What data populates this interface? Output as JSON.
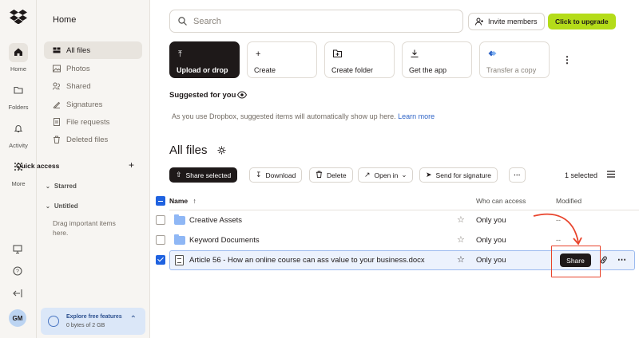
{
  "rail": {
    "items": [
      {
        "label": "Home",
        "icon": "home-icon"
      },
      {
        "label": "Folders",
        "icon": "folder-icon"
      },
      {
        "label": "Activity",
        "icon": "bell-icon"
      },
      {
        "label": "More",
        "icon": "grid-icon"
      }
    ],
    "avatar": "GM"
  },
  "sidebar": {
    "title": "Home",
    "items": [
      {
        "label": "All files",
        "icon": "all-files-icon"
      },
      {
        "label": "Photos",
        "icon": "photos-icon"
      },
      {
        "label": "Shared",
        "icon": "shared-icon"
      },
      {
        "label": "Signatures",
        "icon": "signatures-icon"
      },
      {
        "label": "File requests",
        "icon": "file-requests-icon"
      },
      {
        "label": "Deleted files",
        "icon": "trash-icon"
      }
    ],
    "quick_access": "Quick access",
    "starred": "Starred",
    "untitled": "Untitled",
    "drag_hint": "Drag important items here.",
    "promo_title": "Explore free features",
    "promo_sub": "0 bytes of 2 GB"
  },
  "topbar": {
    "search_placeholder": "Search",
    "invite": "Invite members",
    "upgrade": "Click to upgrade"
  },
  "cards": [
    {
      "label": "Upload or drop",
      "icon": "upload-icon"
    },
    {
      "label": "Create",
      "icon": "plus-icon"
    },
    {
      "label": "Create folder",
      "icon": "new-folder-icon"
    },
    {
      "label": "Get the app",
      "icon": "download-icon"
    },
    {
      "label": "Transfer a copy",
      "icon": "transfer-icon"
    }
  ],
  "suggested": {
    "title": "Suggested for you",
    "text": "As you use Dropbox, suggested items will automatically show up here.",
    "link": "Learn more"
  },
  "files": {
    "title": "All files",
    "toolbar": {
      "share_selected": "Share selected",
      "download": "Download",
      "delete": "Delete",
      "open_in": "Open in",
      "send_for_signature": "Send for signature",
      "selected_count": "1 selected"
    },
    "columns": {
      "name": "Name",
      "access": "Who can access",
      "modified": "Modified"
    },
    "rows": [
      {
        "name": "Creative Assets",
        "access": "Only you",
        "modified": "--",
        "selected": false,
        "type": "folder"
      },
      {
        "name": "Keyword Documents",
        "access": "Only you",
        "modified": "--",
        "selected": false,
        "type": "folder"
      },
      {
        "name": "Article 56 - How an online course can ass value to your business.docx",
        "access": "Only you",
        "modified": "",
        "selected": true,
        "type": "docx"
      }
    ],
    "share_button": "Share"
  },
  "colors": {
    "accent": "#1f62e0",
    "upgrade": "#b4dc19",
    "highlight": "#e8432b"
  }
}
